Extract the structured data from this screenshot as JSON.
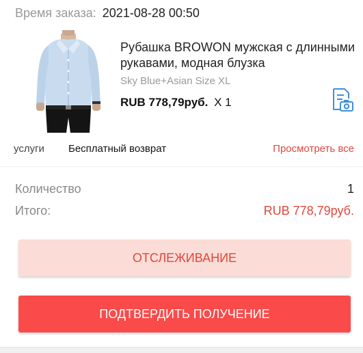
{
  "order": {
    "time_label": "Время заказа:",
    "time_value": "2021-08-28 00:50"
  },
  "product": {
    "title": "Рубашка BROWON мужская с длинными рукавами, модная блузка",
    "variant": "Sky Blue+Asian Size XL",
    "price": "RUB 778,79руб.",
    "quantity": "X 1",
    "photo_icon": "photo-review-icon",
    "image_icon": "shirt-product-image"
  },
  "services": {
    "label": "услуги",
    "value": "Бесплатный возврат",
    "link": "Просмотреть все"
  },
  "summary": {
    "quantity_label": "Количество",
    "quantity_value": "1",
    "total_label": "Итого:",
    "total_value": "RUB 778,79руб."
  },
  "actions": {
    "track_label": "ОТСЛЕЖИВАНИЕ",
    "confirm_label": "ПОДТВЕРДИТЬ ПОЛУЧЕНИЕ"
  },
  "colors": {
    "accent_red": "#e0473b",
    "confirm_bg": "#fa4a4a",
    "track_bg": "#fcdcd6",
    "icon_blue": "#3f8fd6"
  }
}
